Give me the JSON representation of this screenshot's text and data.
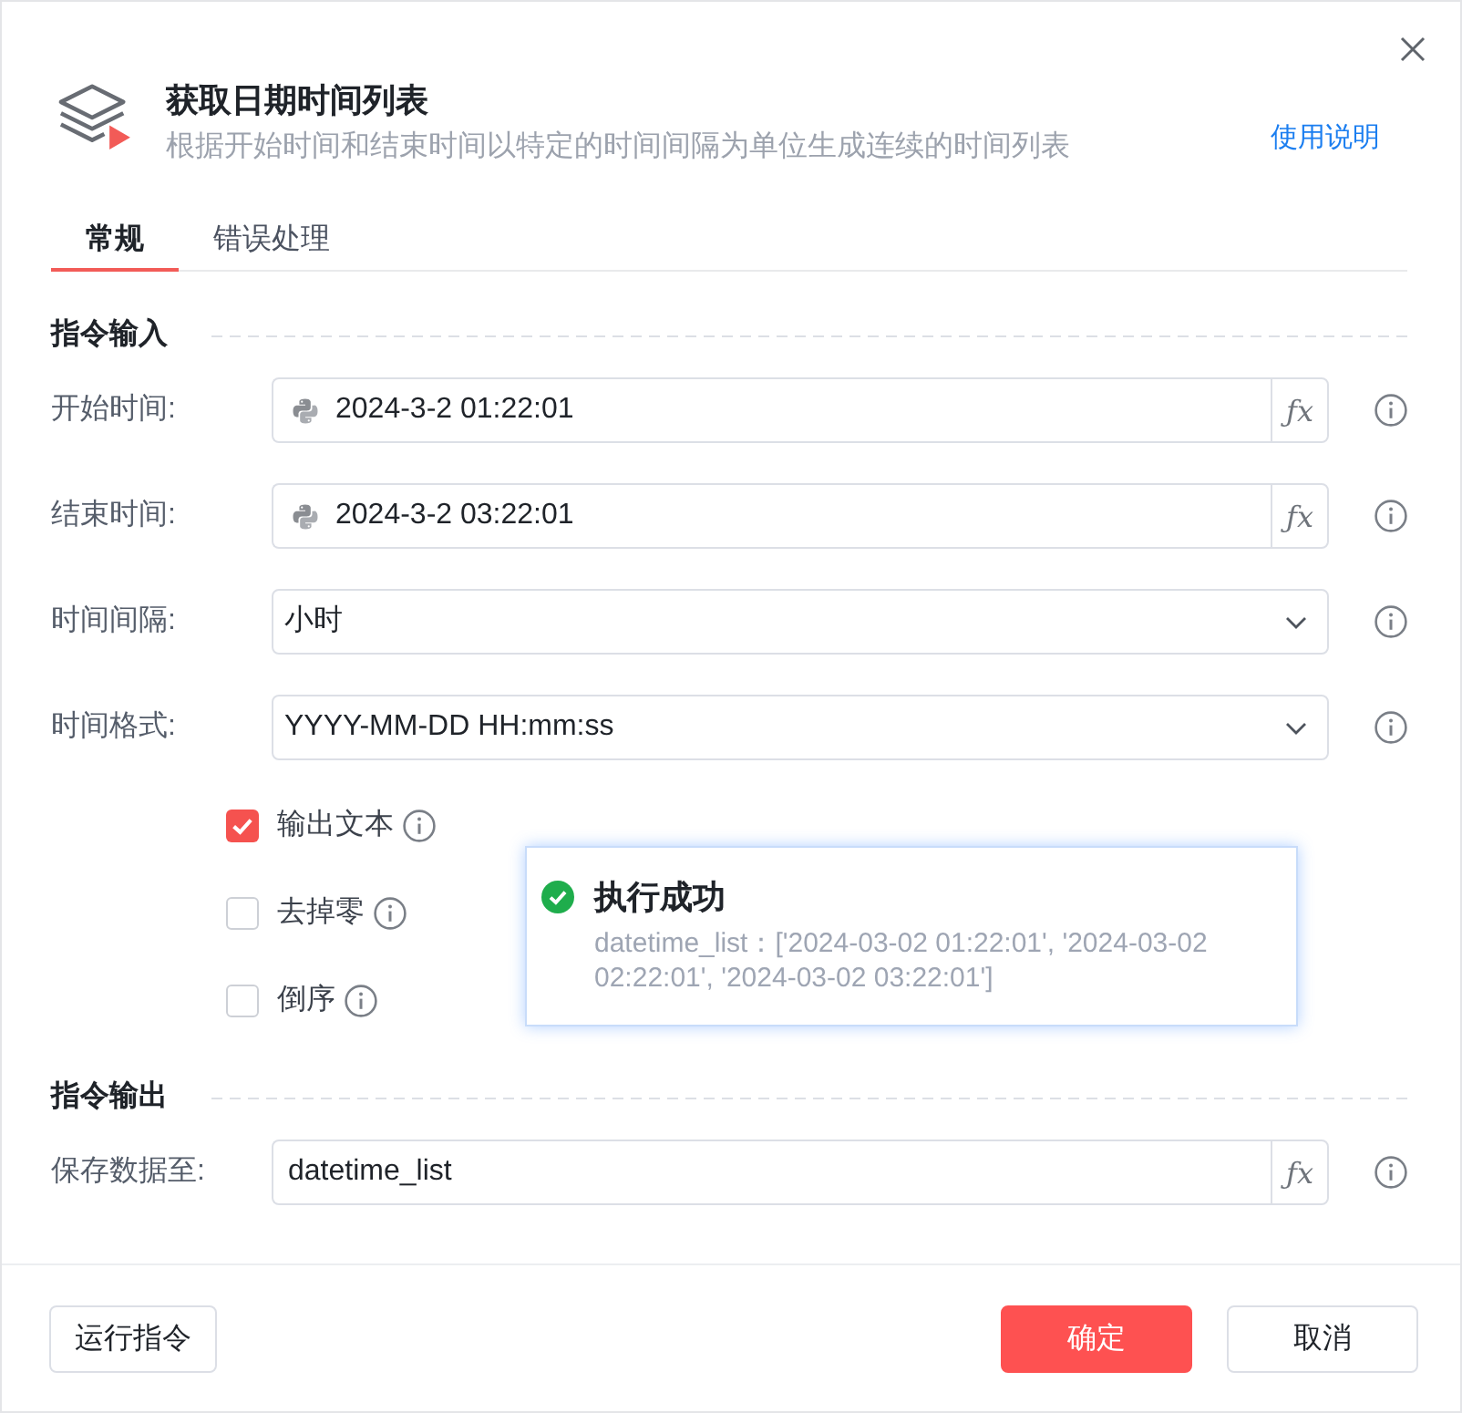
{
  "dialog": {
    "title": "获取日期时间列表",
    "description": "根据开始时间和结束时间以特定的时间间隔为单位生成连续的时间列表",
    "help_link": "使用说明"
  },
  "tabs": [
    {
      "label": "常规",
      "selected": true
    },
    {
      "label": "错误处理",
      "selected": false
    }
  ],
  "sections": [
    {
      "title": "指令输入",
      "fields": [
        {
          "kind": "expression",
          "label": "开始时间:",
          "value": "2024-3-2 01:22:01",
          "button": "ƒx"
        },
        {
          "kind": "expression",
          "label": "结束时间:",
          "value": "2024-3-2 03:22:01",
          "button": "ƒx"
        },
        {
          "kind": "select",
          "label": "时间间隔:",
          "value": "小时"
        },
        {
          "kind": "select",
          "label": "时间格式:",
          "value": "YYYY-MM-DD HH:mm:ss"
        }
      ],
      "options": [
        {
          "label": "输出文本",
          "checked": true
        },
        {
          "label": "去掉零",
          "checked": false
        },
        {
          "label": "倒序",
          "checked": false
        }
      ]
    },
    {
      "title": "指令输出",
      "fields": [
        {
          "kind": "variable",
          "label": "保存数据至:",
          "value": "datetime_list",
          "button": "ƒx"
        }
      ]
    }
  ],
  "toast": {
    "kind": "success",
    "title": "执行成功",
    "message": "datetime_list：['2024-03-02 01:22:01', '2024-03-02 02:22:01', '2024-03-02 03:22:01']"
  },
  "footer": {
    "left_buttons": [
      {
        "label": "运行指令",
        "kind": "default"
      }
    ],
    "right_buttons": [
      {
        "label": "确定",
        "kind": "primary"
      },
      {
        "label": "取消",
        "kind": "default"
      }
    ]
  }
}
